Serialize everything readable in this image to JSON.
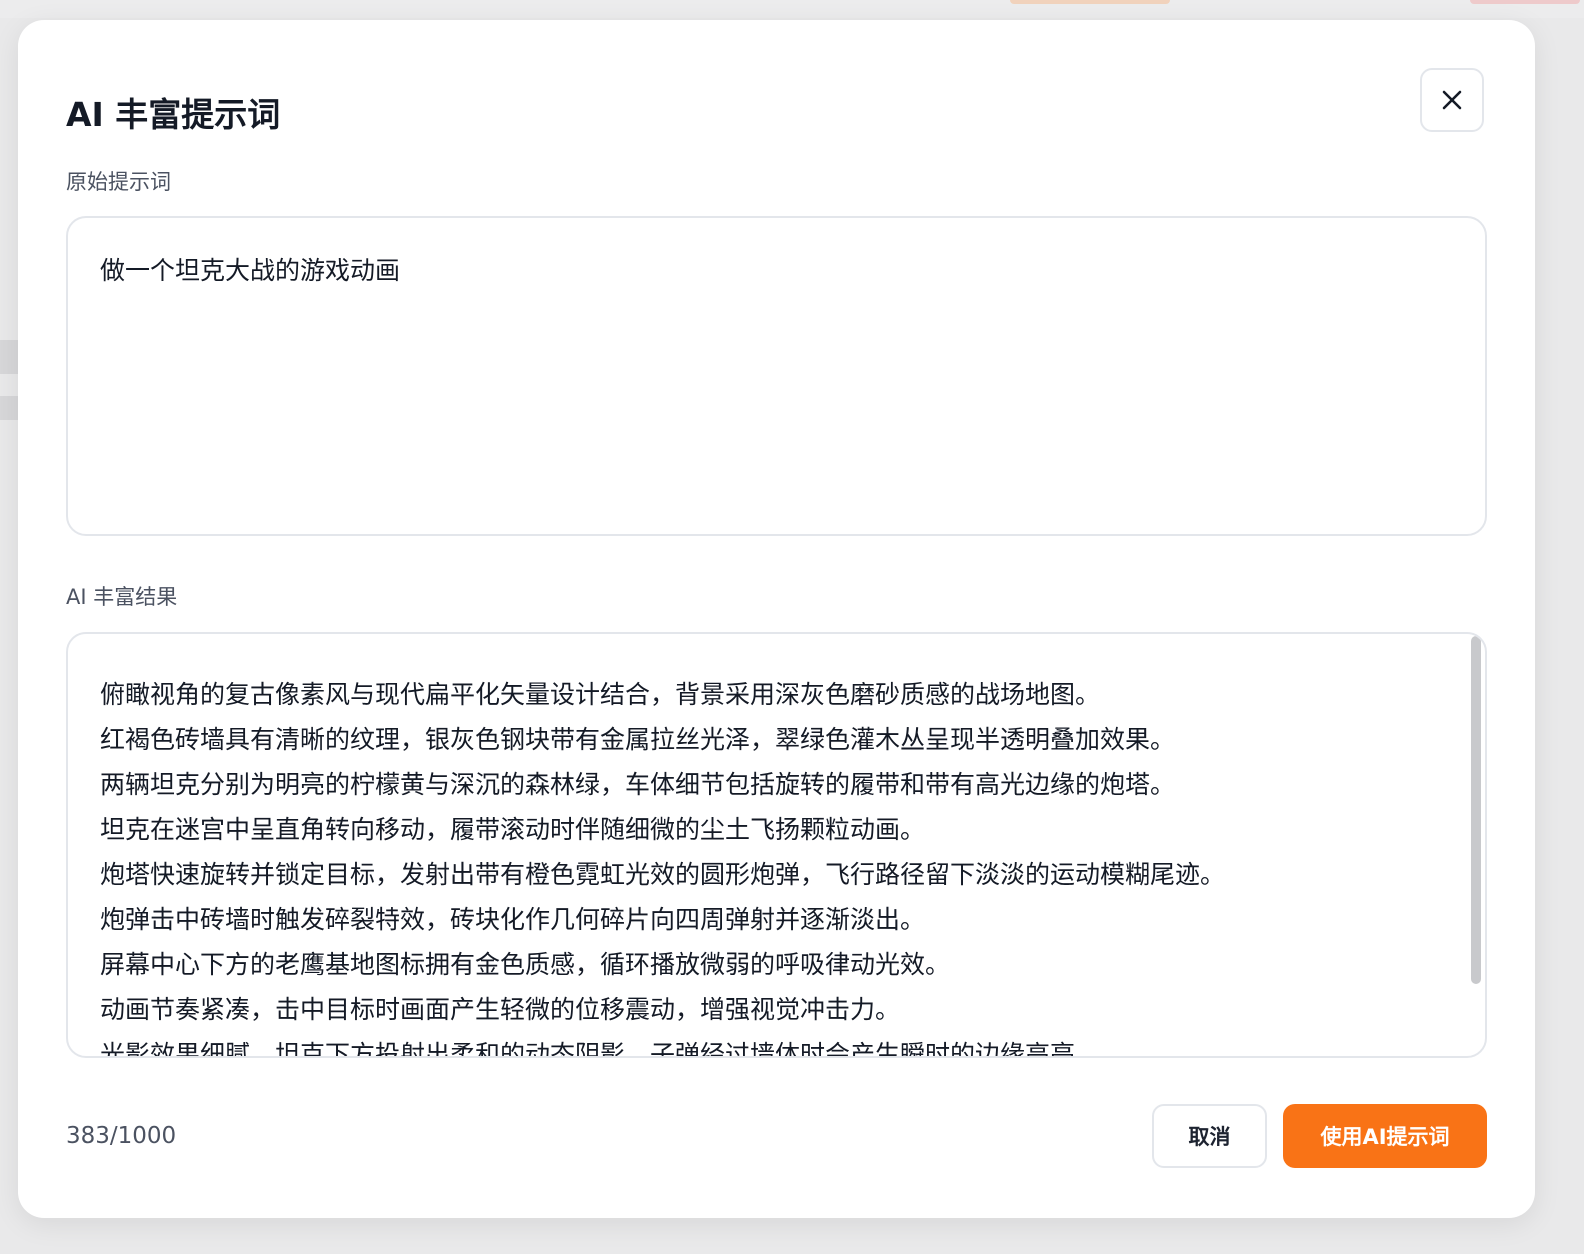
{
  "modal": {
    "title": "AI 丰富提示词",
    "close_icon": "close-icon"
  },
  "original": {
    "label": "原始提示词",
    "text": "做一个坦克大战的游戏动画"
  },
  "result": {
    "label": "AI 丰富结果",
    "lines": [
      "俯瞰视角的复古像素风与现代扁平化矢量设计结合，背景采用深灰色磨砂质感的战场地图。",
      "红褐色砖墙具有清晰的纹理，银灰色钢块带有金属拉丝光泽，翠绿色灌木丛呈现半透明叠加效果。",
      "两辆坦克分别为明亮的柠檬黄与深沉的森林绿，车体细节包括旋转的履带和带有高光边缘的炮塔。",
      "坦克在迷宫中呈直角转向移动，履带滚动时伴随细微的尘土飞扬颗粒动画。",
      "炮塔快速旋转并锁定目标，发射出带有橙色霓虹光效的圆形炮弹，飞行路径留下淡淡的运动模糊尾迹。",
      "炮弹击中砖墙时触发碎裂特效，砖块化作几何碎片向四周弹射并逐渐淡出。",
      "屏幕中心下方的老鹰基地图标拥有金色质感，循环播放微弱的呼吸律动光效。",
      "动画节奏紧凑，击中目标时画面产生轻微的位移震动，增强视觉冲击力。",
      "光影效果细腻，坦克下方投射出柔和的动态阴影，子弹经过墙体时会产生瞬时的边缘高亮。"
    ]
  },
  "footer": {
    "char_count": "383/1000",
    "cancel_label": "取消",
    "use_label": "使用AI提示词"
  },
  "colors": {
    "accent": "#f97316",
    "text": "#141a26",
    "muted": "#4b5261",
    "border": "#e3e6eb"
  }
}
